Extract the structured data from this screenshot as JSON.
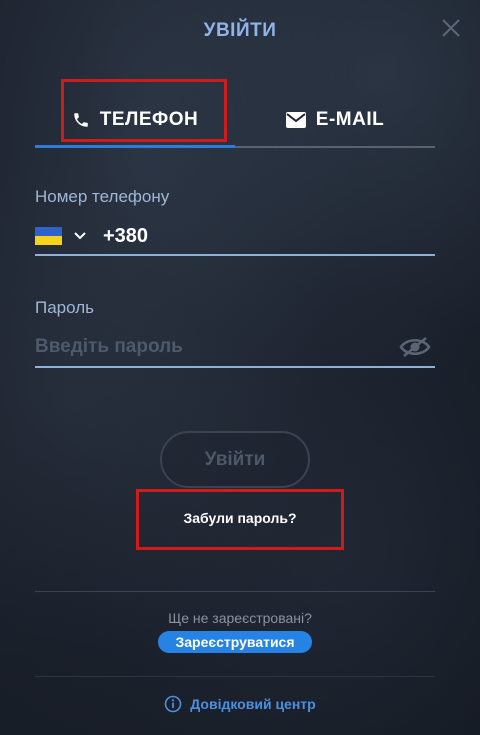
{
  "header": {
    "title": "УВІЙТИ"
  },
  "tabs": [
    {
      "label": "ТЕЛЕФОН",
      "icon": "phone-icon",
      "active": true
    },
    {
      "label": "E-MAIL",
      "icon": "envelope-icon",
      "active": false
    }
  ],
  "phone": {
    "label": "Номер телефону",
    "country_flag": "ukraine-flag",
    "prefix": "+380",
    "value": "",
    "placeholder": ""
  },
  "password": {
    "label": "Пароль",
    "value": "",
    "placeholder": "Введіть пароль"
  },
  "actions": {
    "submit_label": "Увійти",
    "forgot_label": "Забули пароль?",
    "not_registered": "Ще не зареєстровані?",
    "register_label": "Зареєструватися",
    "help_label": "Довідковий центр"
  },
  "colors": {
    "accent": "#2f7cd6",
    "title": "#8fb4e8",
    "register_bg": "#2683e3",
    "highlight": "#d11a1a"
  }
}
